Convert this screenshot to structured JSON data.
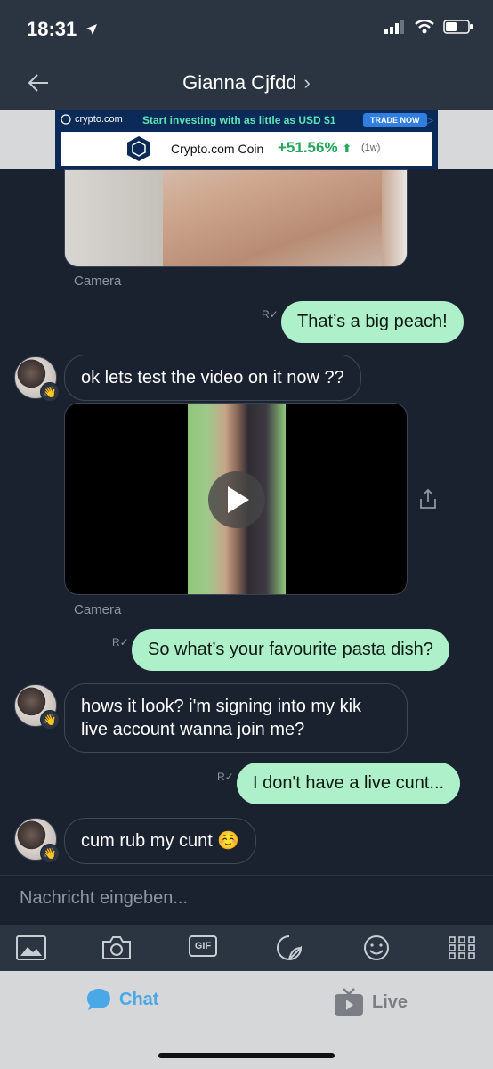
{
  "status": {
    "time": "18:31"
  },
  "nav": {
    "title": "Gianna Cjfdd"
  },
  "ad": {
    "brand": "crypto.com",
    "tagline": "Start investing with as little as USD $1",
    "cta": "TRADE NOW",
    "coin": "Crypto.com Coin",
    "change": "+51.56%",
    "period": "(1w)"
  },
  "messages": {
    "image_caption": "Camera",
    "m1": "That’s a big peach!",
    "m2": "ok lets test the video on it now ??",
    "video_caption": "Camera",
    "m3": "So what’s your favourite pasta dish?",
    "m4": "hows it look? i'm signing into my kik live account wanna join me?",
    "m5": "I don't have a live cunt...",
    "m6": "cum rub my cunt ☺️"
  },
  "input": {
    "placeholder": "Nachricht eingeben..."
  },
  "toolbar": {
    "gif_label": "GIF"
  },
  "tabs": {
    "chat": "Chat",
    "live": "Live"
  },
  "colors": {
    "outgoing": "#aef0c9",
    "background": "#1a2230",
    "accent": "#4aa8e6"
  }
}
